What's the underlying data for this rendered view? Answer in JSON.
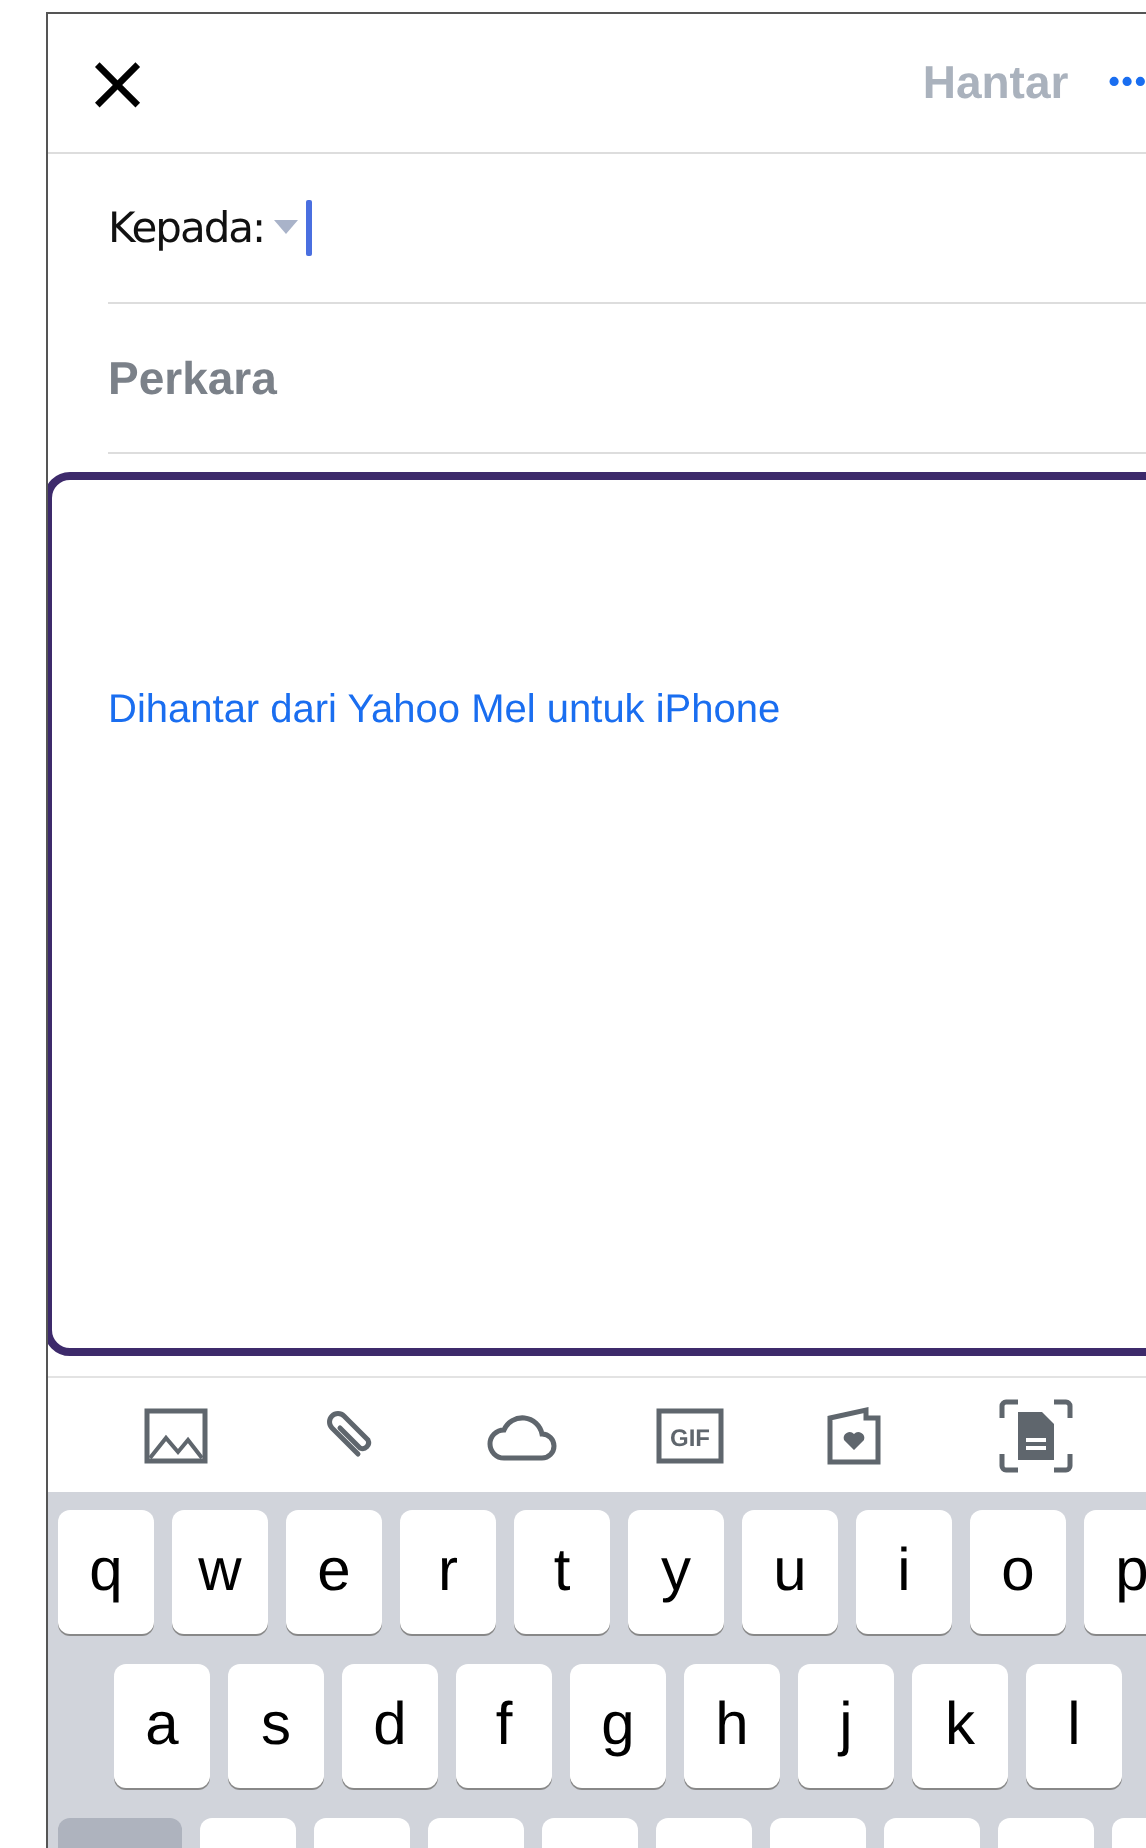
{
  "header": {
    "close": "×",
    "send": {
      "label": "Hantar",
      "disabled": true
    },
    "more": "•••"
  },
  "to": {
    "label": "Kepada:",
    "focused": true
  },
  "subject": {
    "placeholder": "Perkara"
  },
  "body": {
    "signature": "Dihantar dari Yahoo Mel untuk iPhone",
    "focused": true
  },
  "toolbar": [
    {
      "kind": "image"
    },
    {
      "kind": "attach"
    },
    {
      "kind": "cloud"
    },
    {
      "kind": "gif",
      "label": "GIF"
    },
    {
      "kind": "card"
    },
    {
      "kind": "scan"
    }
  ],
  "keyboard": {
    "rows": [
      [
        "q",
        "w",
        "e",
        "r",
        "t",
        "y",
        "u",
        "i",
        "o",
        "p"
      ],
      [
        "a",
        "s",
        "d",
        "f",
        "g",
        "h",
        "j",
        "k",
        "l"
      ]
    ]
  }
}
